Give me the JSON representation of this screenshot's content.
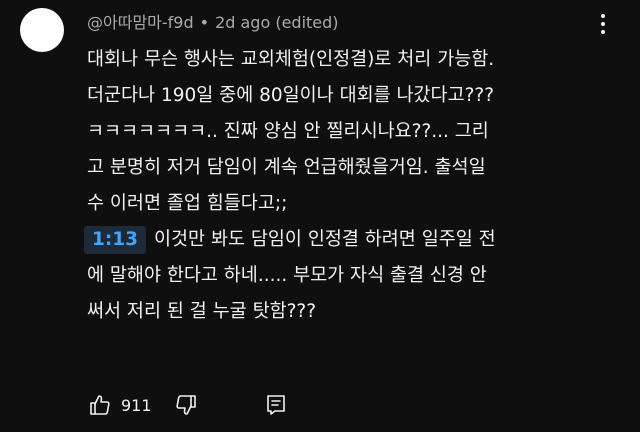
{
  "comment": {
    "author": "@아따맘마-f9d",
    "separator": "•",
    "time": "2d ago",
    "edited": "(edited)",
    "lines": [
      "대회나 무슨 행사는 교외체험(인정결)로 처리 가능함.",
      "더군다나 190일 중에 80일이나 대회를 나갔다고???",
      "ㅋㅋㅋㅋㅋㅋㅋ.. 진짜 양심 안 찔리시나요??... 그리",
      "고 분명히 저거 담임이 계속 언급해줬을거임. 출석일",
      "수 이러면 졸업 힘들다고;;"
    ],
    "timestamp_link": "1:13",
    "timestamp_line_text": "이것만 봐도 담임이 인정결 하려면 일주일 전",
    "lines_after": [
      "에 말해야 한다고 하네..... 부모가 자식 출결 신경 안",
      "써서 저리 된 걸 누굴 탓함???"
    ]
  },
  "actions": {
    "like_count": "911",
    "like_icon": "thumbs-up-icon",
    "dislike_icon": "thumbs-down-icon",
    "reply_icon": "comment-reply-icon"
  },
  "menu_icon": "more-vertical-icon",
  "colors": {
    "background": "#0f0f0f",
    "text": "#f1f1f1",
    "meta": "#aaaaaa",
    "link": "#3ea6ff"
  }
}
